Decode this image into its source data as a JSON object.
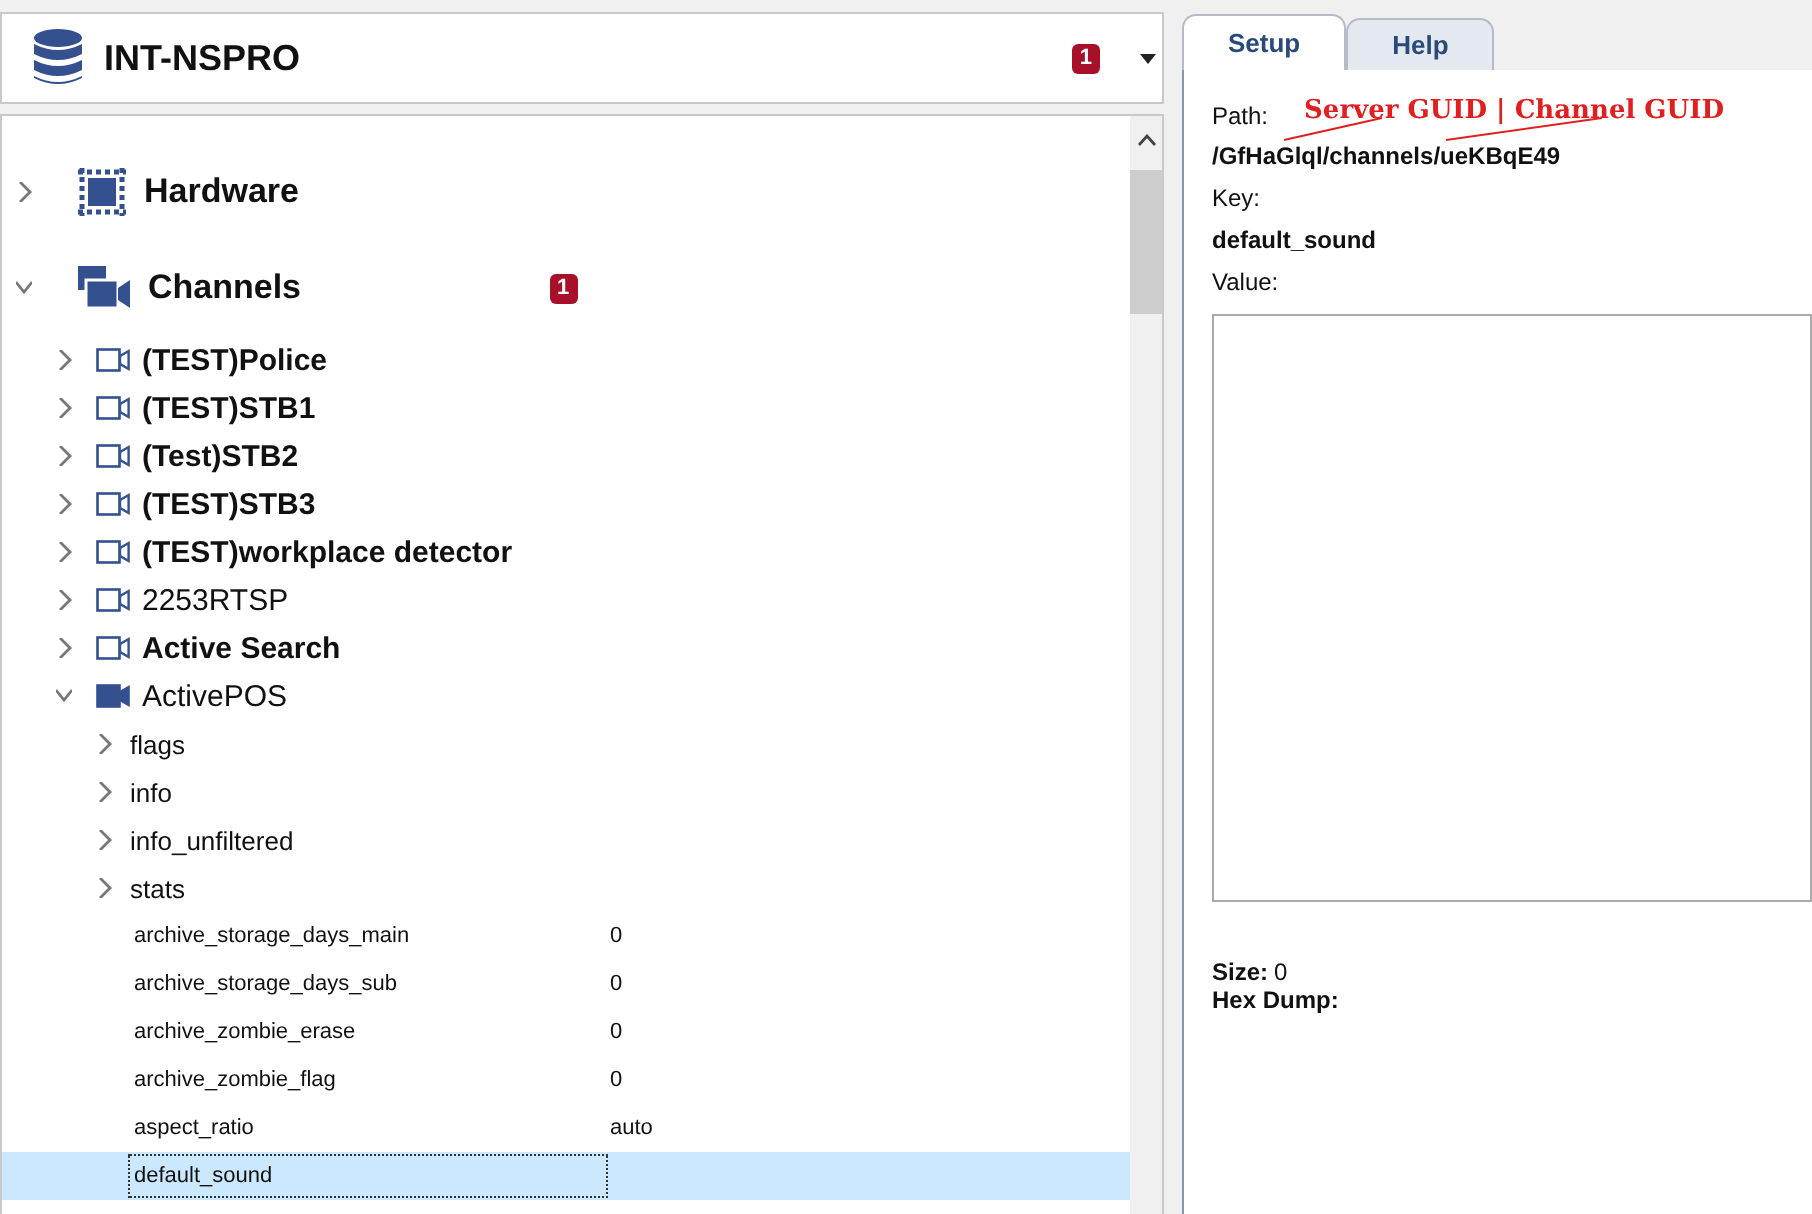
{
  "header": {
    "title": "INT-NSPRO",
    "badge": "1"
  },
  "tree": [
    {
      "label": "Hardware",
      "kind": "hardware",
      "expanded": false
    },
    {
      "label": "Channels",
      "kind": "channels",
      "expanded": true,
      "badge": "1",
      "children": [
        {
          "label": "(TEST)Police",
          "emphasized": true,
          "expanded": false,
          "streaming": false
        },
        {
          "label": "(TEST)STB1",
          "emphasized": true,
          "expanded": false,
          "streaming": false
        },
        {
          "label": "(Test)STB2",
          "emphasized": true,
          "expanded": false,
          "streaming": false
        },
        {
          "label": "(TEST)STB3",
          "emphasized": true,
          "expanded": false,
          "streaming": false
        },
        {
          "label": "(TEST)workplace detector",
          "emphasized": true,
          "expanded": false,
          "streaming": false
        },
        {
          "label": "2253RTSP",
          "emphasized": false,
          "expanded": false,
          "streaming": false
        },
        {
          "label": "Active Search",
          "emphasized": true,
          "expanded": false,
          "streaming": false
        },
        {
          "label": "ActivePOS",
          "emphasized": false,
          "expanded": true,
          "streaming": true,
          "children": [
            {
              "kind": "folder",
              "label": "flags"
            },
            {
              "kind": "folder",
              "label": "info"
            },
            {
              "kind": "folder",
              "label": "info_unfiltered"
            },
            {
              "kind": "folder",
              "label": "stats"
            },
            {
              "kind": "property",
              "label": "archive_storage_days_main",
              "value": "0",
              "selected": false
            },
            {
              "kind": "property",
              "label": "archive_storage_days_sub",
              "value": "0",
              "selected": false
            },
            {
              "kind": "property",
              "label": "archive_zombie_erase",
              "value": "0",
              "selected": false
            },
            {
              "kind": "property",
              "label": "archive_zombie_flag",
              "value": "0",
              "selected": false
            },
            {
              "kind": "property",
              "label": "aspect_ratio",
              "value": "auto",
              "selected": false
            },
            {
              "kind": "property",
              "label": "default_sound",
              "selected": true
            }
          ]
        }
      ]
    }
  ],
  "tabs": [
    {
      "label": "Setup",
      "selected": true
    },
    {
      "label": "Help",
      "selected": false
    }
  ],
  "details": {
    "path_label": "Path:",
    "annotation": "Server GUID | Channel GUID",
    "path": "/GfHaGlql/channels/ueKBqE49",
    "key_label": "Key:",
    "key": "default_sound",
    "value_label": "Value:",
    "size_label": "Size:",
    "size": "0",
    "hex_label": "Hex Dump:"
  }
}
